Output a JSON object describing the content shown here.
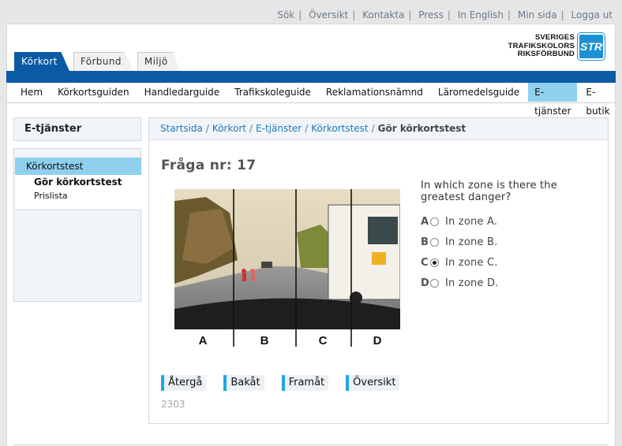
{
  "top_links": [
    "Sök",
    "Översikt",
    "Kontakta",
    "Press",
    "In English",
    "Min sida",
    "Logga ut"
  ],
  "tabs": [
    {
      "label": "Körkort",
      "active": true
    },
    {
      "label": "Förbund",
      "active": false
    },
    {
      "label": "Miljö",
      "active": false
    }
  ],
  "logo": {
    "line1": "SVERIGES",
    "line2": "TRAFIKSKOLORS",
    "line3": "RIKSFÖRBUND",
    "badge": "STR"
  },
  "nav": [
    "Hem",
    "Körkortsguiden",
    "Handledarguide",
    "Trafikskoleguide",
    "Reklamationsnämnd",
    "Läromedelsguide",
    "E-tjänster",
    "E-butik"
  ],
  "nav_active": "E-tjänster",
  "sidebar": {
    "title": "E-tjänster",
    "selected": "Körkortstest",
    "sub1": "Gör körkortstest",
    "sub2": "Prislista"
  },
  "breadcrumb": {
    "items": [
      "Startsida",
      "Körkort",
      "E-tjänster",
      "Körkortstest"
    ],
    "current": "Gör körkortstest"
  },
  "question": {
    "title": "Fråga nr: 17",
    "text": "In which zone is there the greatest danger?",
    "zones": [
      "A",
      "B",
      "C",
      "D"
    ],
    "answers": [
      {
        "letter": "A",
        "text": "In zone A.",
        "checked": false
      },
      {
        "letter": "B",
        "text": "In zone B.",
        "checked": false
      },
      {
        "letter": "C",
        "text": "In zone C.",
        "checked": true
      },
      {
        "letter": "D",
        "text": "In zone D.",
        "checked": false
      }
    ]
  },
  "buttons": {
    "back_return": "Återgå",
    "back": "Bakåt",
    "forward": "Framåt",
    "overview": "Översikt"
  },
  "code": "2303",
  "colors": {
    "brand_blue": "#0a5aa5",
    "active_nav": "#8fd0ef",
    "link": "#1a7ac0",
    "button_accent": "#1ea7e0"
  }
}
